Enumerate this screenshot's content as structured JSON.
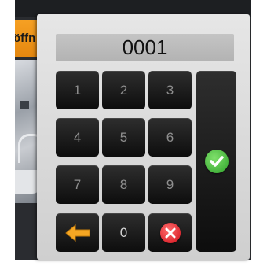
{
  "background": {
    "banner_text": "öffn"
  },
  "keypad": {
    "display_value": "0001",
    "keys": [
      "1",
      "2",
      "3",
      "4",
      "5",
      "6",
      "7",
      "8",
      "9",
      "0"
    ],
    "backspace_icon": "left-arrow-icon",
    "clear_icon": "x-circle-icon",
    "confirm_icon": "checkmark-circle-icon",
    "colors": {
      "panel": "#dcdcdc",
      "key": "#1a1a1a",
      "confirm": "#3dbb35",
      "clear": "#e0131d",
      "backspace": "#f5a623"
    }
  }
}
